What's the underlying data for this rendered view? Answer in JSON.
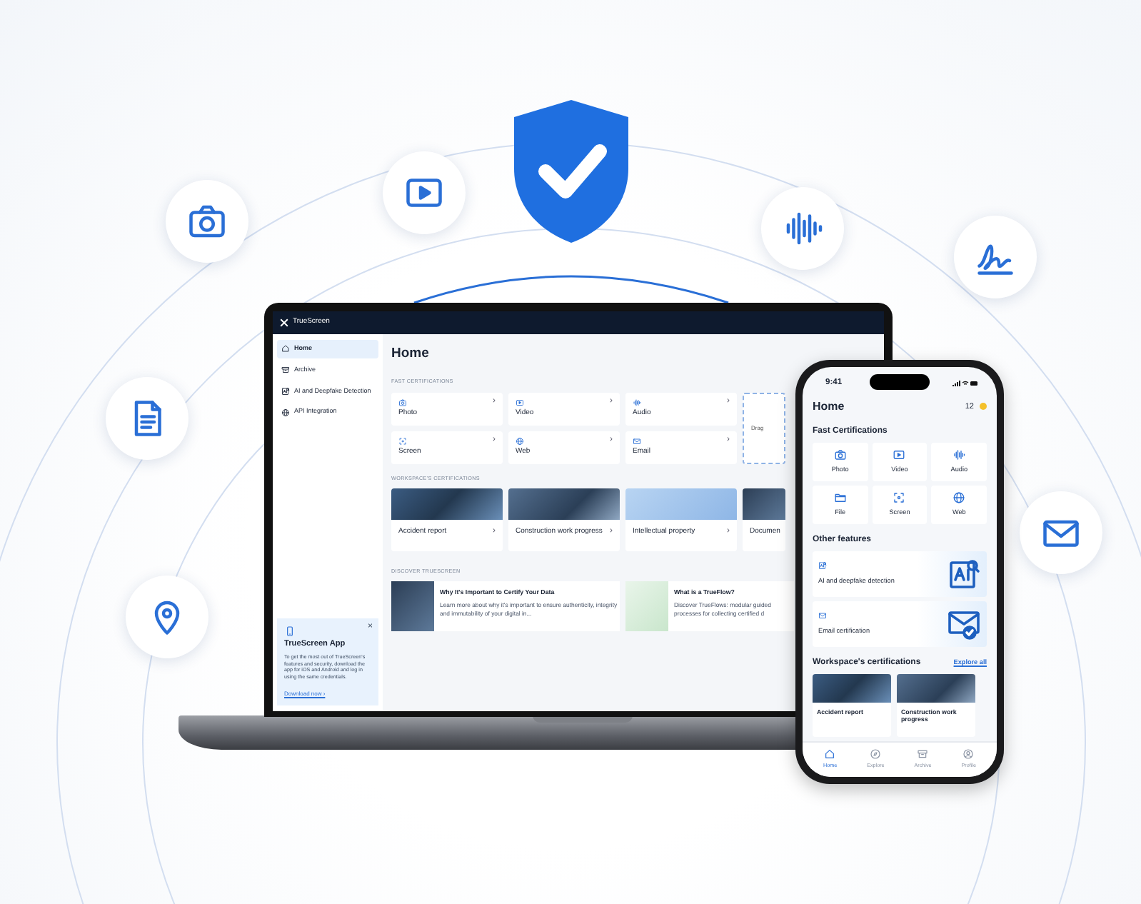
{
  "laptop": {
    "topbar": {
      "brand": "TrueScreen"
    },
    "sidebar": {
      "items": [
        {
          "label": "Home",
          "selected": true
        },
        {
          "label": "Archive",
          "selected": false
        },
        {
          "label": "AI and Deepfake Detection",
          "selected": false
        },
        {
          "label": "API Integration",
          "selected": false
        }
      ],
      "promo": {
        "close": "×",
        "title": "TrueScreen App",
        "text": "To get the most out of TrueScreen's features and security, download the app for iOS and Android and log in using the same credentials.",
        "link": "Download now ›"
      }
    },
    "main": {
      "title": "Home",
      "fast_certifications": {
        "heading": "FAST CERTIFICATIONS",
        "tiles": [
          {
            "label": "Photo",
            "chevron": "›"
          },
          {
            "label": "Video",
            "chevron": "›"
          },
          {
            "label": "Audio",
            "chevron": "›"
          },
          {
            "label": "Screen",
            "chevron": "›"
          },
          {
            "label": "Web",
            "chevron": "›"
          },
          {
            "label": "Email",
            "chevron": "›"
          }
        ],
        "drop_card": "Drag"
      },
      "workspace_certifications": {
        "heading": "WORKSPACE'S CERTIFICATIONS",
        "cards": [
          {
            "label": "Accident report",
            "chevron": "›"
          },
          {
            "label": "Construction work progress",
            "chevron": "›"
          },
          {
            "label": "Intellectual property",
            "chevron": "›"
          },
          {
            "label": "Documen"
          }
        ]
      },
      "discover": {
        "heading": "DISCOVER TRUESCREEN",
        "articles": [
          {
            "title": "Why It's Important to Certify Your Data",
            "text": "Learn more about why it's important to ensure authenticity, integrity and immutability of your digital in..."
          },
          {
            "title": "What is a TrueFlow?",
            "text": "Discover TrueFlows: modular guided processes for collecting certified d"
          }
        ]
      }
    }
  },
  "phone": {
    "time": "9:41",
    "title": "Home",
    "credits": "12",
    "fast_certifications": {
      "heading": "Fast Certifications",
      "tiles": [
        {
          "label": "Photo"
        },
        {
          "label": "Video"
        },
        {
          "label": "Audio"
        },
        {
          "label": "File"
        },
        {
          "label": "Screen"
        },
        {
          "label": "Web"
        }
      ]
    },
    "other_features": {
      "heading": "Other features",
      "items": [
        {
          "label": "AI and deepfake detection"
        },
        {
          "label": "Email certification"
        }
      ]
    },
    "workspace_certifications": {
      "heading": "Workspace's certifications",
      "link": "Explore all",
      "cards": [
        {
          "label": "Accident report"
        },
        {
          "label": "Construction work progress"
        }
      ]
    },
    "tabbar": [
      {
        "label": "Home",
        "selected": true
      },
      {
        "label": "Explore",
        "selected": false
      },
      {
        "label": "Archive",
        "selected": false
      },
      {
        "label": "Profile",
        "selected": false
      }
    ]
  }
}
